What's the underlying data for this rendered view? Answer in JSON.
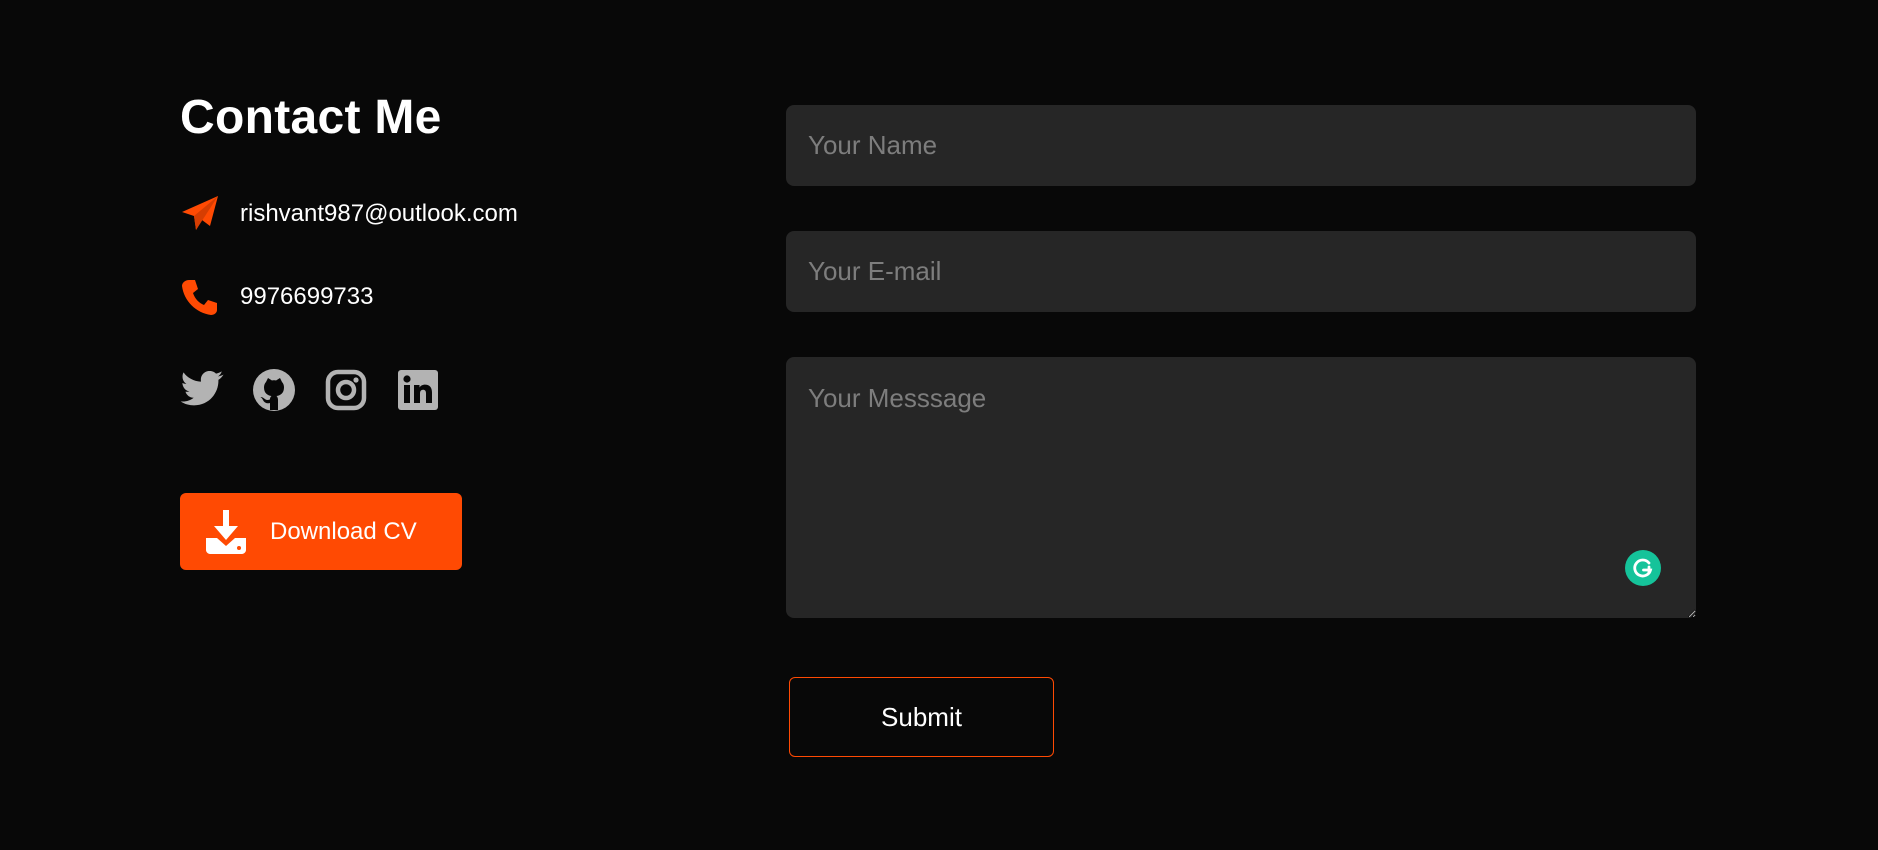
{
  "contact": {
    "title": "Contact Me",
    "email": "rishvant987@outlook.com",
    "phone": "9976699733",
    "icons": {
      "email": "paper-plane-icon",
      "phone": "phone-icon"
    },
    "socials": [
      {
        "name": "twitter",
        "icon": "twitter-icon"
      },
      {
        "name": "github",
        "icon": "github-icon"
      },
      {
        "name": "instagram",
        "icon": "instagram-icon"
      },
      {
        "name": "linkedin",
        "icon": "linkedin-icon"
      }
    ],
    "download_button": {
      "label": "Download CV",
      "icon": "download-icon"
    }
  },
  "form": {
    "name_placeholder": "Your Name",
    "email_placeholder": "Your E-mail",
    "message_placeholder": "Your Messsage",
    "submit_label": "Submit",
    "grammarly_icon": "grammarly-icon"
  },
  "colors": {
    "background": "#080808",
    "accent": "#ff4a03",
    "field_background": "#262626",
    "placeholder": "#7d7d7d",
    "social_icon": "#b3b3b3",
    "grammarly": "#15c39a"
  }
}
